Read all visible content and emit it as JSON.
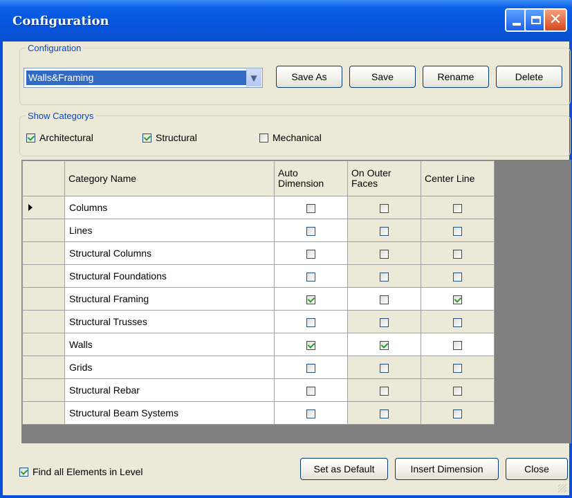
{
  "window": {
    "title": "Configuration"
  },
  "config_group": {
    "legend": "Configuration",
    "selected": "Walls&Framing",
    "buttons": {
      "save_as": "Save As",
      "save": "Save",
      "rename": "Rename",
      "delete": "Delete"
    }
  },
  "categories_group": {
    "legend": "Show Categorys",
    "items": [
      {
        "label": "Architectural",
        "checked": true
      },
      {
        "label": "Structural",
        "checked": true
      },
      {
        "label": "Mechanical",
        "checked": false
      }
    ]
  },
  "grid": {
    "columns": [
      "Category Name",
      "Auto\nDimension",
      "On Outer\nFaces",
      "Center Line"
    ],
    "rows": [
      {
        "name": "Columns",
        "auto": false,
        "outer": false,
        "center": false,
        "current": true
      },
      {
        "name": "Lines",
        "auto": false,
        "outer": false,
        "center": false
      },
      {
        "name": "Structural Columns",
        "auto": false,
        "outer": false,
        "center": false
      },
      {
        "name": "Structural Foundations",
        "auto": false,
        "outer": false,
        "center": false
      },
      {
        "name": "Structural Framing",
        "auto": true,
        "outer": false,
        "center": true
      },
      {
        "name": "Structural Trusses",
        "auto": false,
        "outer": false,
        "center": false
      },
      {
        "name": "Walls",
        "auto": true,
        "outer": true,
        "center": false
      },
      {
        "name": "Grids",
        "auto": false,
        "outer": false,
        "center": false
      },
      {
        "name": "Structural Rebar",
        "auto": false,
        "outer": false,
        "center": false
      },
      {
        "name": "Structural Beam Systems",
        "auto": false,
        "outer": false,
        "center": false
      }
    ]
  },
  "footer": {
    "find_all_label": "Find all Elements in Level",
    "find_all_checked": true,
    "set_default": "Set as Default",
    "insert_dimension": "Insert Dimension",
    "close": "Close"
  }
}
